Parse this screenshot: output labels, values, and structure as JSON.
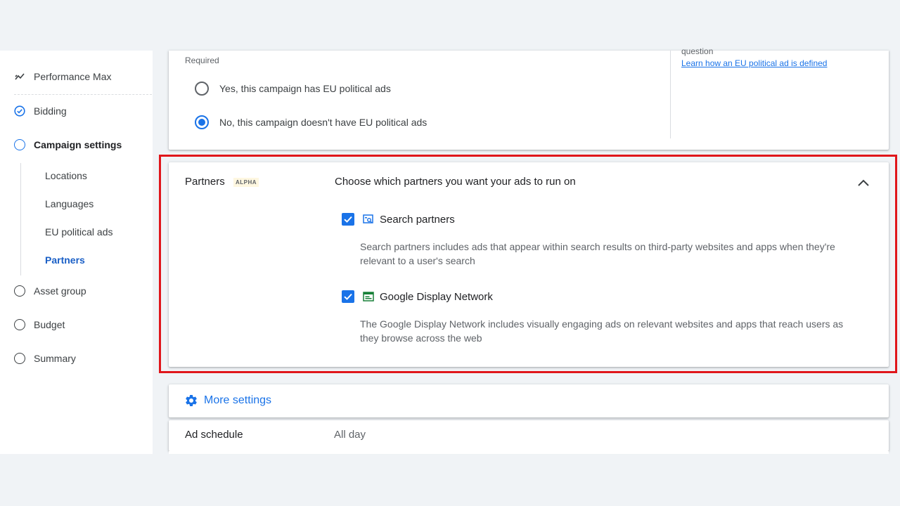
{
  "sidebar": {
    "performance_max": "Performance Max",
    "bidding": "Bidding",
    "campaign_settings": "Campaign settings",
    "sub_items": [
      "Locations",
      "Languages",
      "EU political ads",
      "Partners"
    ],
    "asset_group": "Asset group",
    "budget": "Budget",
    "summary": "Summary"
  },
  "eu_political": {
    "required_label": "Required",
    "option_yes": "Yes, this campaign has EU political ads",
    "option_no": "No, this campaign doesn't have EU political ads",
    "selected": "no",
    "help_text": "question",
    "help_link": "Learn how an EU political ad is defined"
  },
  "partners": {
    "title": "Partners",
    "badge": "ALPHA",
    "heading": "Choose which partners you want your ads to run on",
    "search_partners": {
      "label": "Search partners",
      "checked": true,
      "description": "Search partners includes ads that appear within search results on third-party websites and apps when they're relevant to a user's search"
    },
    "display_network": {
      "label": "Google Display Network",
      "checked": true,
      "description": "The Google Display Network includes visually engaging ads on relevant websites and apps that reach users as they browse across the web"
    }
  },
  "more_settings": {
    "label": "More settings"
  },
  "ad_schedule": {
    "label": "Ad schedule",
    "value": "All day"
  },
  "colors": {
    "accent": "#1a73e8",
    "highlight_border": "#e0161b"
  }
}
